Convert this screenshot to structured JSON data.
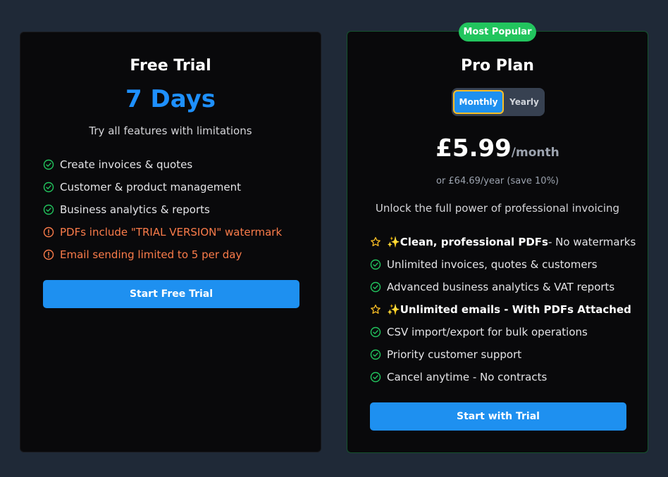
{
  "free": {
    "title": "Free Trial",
    "duration": "7 Days",
    "subtitle": "Try all features with limitations",
    "features": [
      {
        "text": "Create invoices & quotes",
        "icon": "check-circle-icon",
        "kind": "ok"
      },
      {
        "text": "Customer & product management",
        "icon": "check-circle-icon",
        "kind": "ok"
      },
      {
        "text": "Business analytics & reports",
        "icon": "check-circle-icon",
        "kind": "ok"
      },
      {
        "text": "PDFs include \"TRIAL VERSION\" watermark",
        "icon": "alert-circle-icon",
        "kind": "warn"
      },
      {
        "text": "Email sending limited to 5 per day",
        "icon": "alert-circle-icon",
        "kind": "warn"
      }
    ],
    "cta": "Start Free Trial"
  },
  "pro": {
    "badge": "Most Popular",
    "title": "Pro Plan",
    "toggle": {
      "monthly": "Monthly",
      "yearly": "Yearly",
      "selected": "Monthly"
    },
    "price": "£5.99",
    "period": "/month",
    "yearly_note": "or £64.69/year (save 10%)",
    "subtitle": "Unlock the full power of professional invoicing",
    "features": [
      {
        "sparkle": "✨",
        "bold": "Clean, professional PDFs",
        "rest": "- No watermarks",
        "icon": "star-icon",
        "kind": "star"
      },
      {
        "text": "Unlimited invoices, quotes & customers",
        "icon": "check-circle-icon",
        "kind": "ok"
      },
      {
        "text": "Advanced business analytics & VAT reports",
        "icon": "check-circle-icon",
        "kind": "ok"
      },
      {
        "sparkle": "✨",
        "bold": "Unlimited emails - With PDFs Attached",
        "rest": "",
        "icon": "star-icon",
        "kind": "star"
      },
      {
        "text": "CSV import/export for bulk operations",
        "icon": "check-circle-icon",
        "kind": "ok"
      },
      {
        "text": "Priority customer support",
        "icon": "check-circle-icon",
        "kind": "ok"
      },
      {
        "text": "Cancel anytime - No contracts",
        "icon": "check-circle-icon",
        "kind": "ok"
      }
    ],
    "cta": "Start with Trial"
  },
  "colors": {
    "background": "#1f2937",
    "card": "#09090b",
    "accent_blue": "#1e90f0",
    "check_green": "#22c55e",
    "warning_orange": "#fb7c4a",
    "star_yellow": "#fbbf24"
  }
}
